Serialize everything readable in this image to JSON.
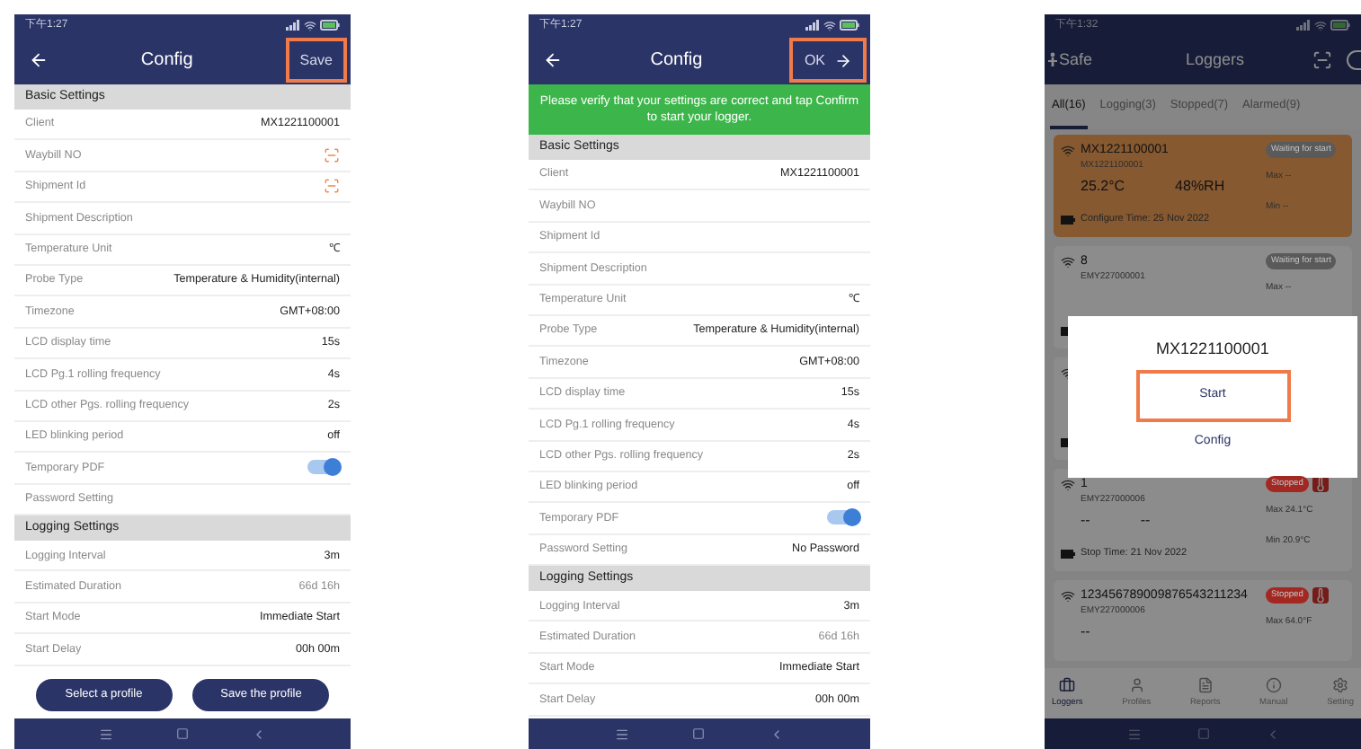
{
  "phones": [
    {
      "kind": "config",
      "status_time": "下午1:27",
      "title": "Config",
      "action": {
        "label": "Save",
        "arrow": false,
        "highlighted": true
      },
      "sections": [
        {
          "heading": "Basic Settings",
          "rows": [
            {
              "kind": "text",
              "label": "Client",
              "value": "MX1221100001"
            },
            {
              "kind": "scan",
              "label": "Waybill NO"
            },
            {
              "kind": "scan",
              "label": "Shipment Id"
            },
            {
              "kind": "text",
              "label": "Shipment Description"
            },
            {
              "kind": "text",
              "label": "Temperature Unit",
              "value": "℃"
            },
            {
              "kind": "text",
              "label": "Probe Type",
              "value": "Temperature & Humidity(internal)"
            },
            {
              "kind": "text",
              "label": "Timezone",
              "value": "GMT+08:00"
            },
            {
              "kind": "text",
              "label": "LCD display time",
              "value": "15s"
            },
            {
              "kind": "text",
              "label": "LCD Pg.1 rolling frequency",
              "value": "4s"
            },
            {
              "kind": "text",
              "label": "LCD other Pgs. rolling frequency",
              "value": "2s"
            },
            {
              "kind": "text",
              "label": "LED blinking period",
              "value": "off"
            },
            {
              "kind": "toggle",
              "label": "Temporary PDF",
              "on": true
            },
            {
              "kind": "text",
              "label": "Password Setting"
            }
          ]
        },
        {
          "heading": "Logging Settings",
          "rows": [
            {
              "kind": "text",
              "label": "Logging Interval",
              "value": "3m"
            },
            {
              "kind": "text",
              "label": "Estimated Duration",
              "value": "66d 16h",
              "muted": true
            },
            {
              "kind": "text",
              "label": "Start Mode",
              "value": "Immediate Start"
            },
            {
              "kind": "text",
              "label": "Start Delay",
              "value": "00h 00m"
            }
          ]
        }
      ],
      "buttons": [
        {
          "label": "Select a profile"
        },
        {
          "label": "Save the profile"
        }
      ]
    },
    {
      "kind": "config",
      "status_time": "下午1:27",
      "title": "Config",
      "action": {
        "label": "OK",
        "arrow": true,
        "highlighted": true
      },
      "banner": "Please verify that your settings are correct and tap Confirm to start your logger.",
      "sections": [
        {
          "heading": "Basic Settings",
          "rows": [
            {
              "kind": "text",
              "label": "Client",
              "value": "MX1221100001"
            },
            {
              "kind": "text",
              "label": "Waybill NO"
            },
            {
              "kind": "text",
              "label": "Shipment Id"
            },
            {
              "kind": "text",
              "label": "Shipment Description"
            },
            {
              "kind": "text",
              "label": "Temperature Unit",
              "value": "℃"
            },
            {
              "kind": "text",
              "label": "Probe Type",
              "value": "Temperature & Humidity(internal)"
            },
            {
              "kind": "text",
              "label": "Timezone",
              "value": "GMT+08:00"
            },
            {
              "kind": "text",
              "label": "LCD display time",
              "value": "15s"
            },
            {
              "kind": "text",
              "label": "LCD Pg.1 rolling frequency",
              "value": "4s"
            },
            {
              "kind": "text",
              "label": "LCD other Pgs. rolling frequency",
              "value": "2s"
            },
            {
              "kind": "text",
              "label": "LED blinking period",
              "value": "off"
            },
            {
              "kind": "toggle",
              "label": "Temporary PDF",
              "on": true
            },
            {
              "kind": "text",
              "label": "Password Setting",
              "value": "No Password"
            }
          ]
        },
        {
          "heading": "Logging Settings",
          "rows": [
            {
              "kind": "text",
              "label": "Logging Interval",
              "value": "3m"
            },
            {
              "kind": "text",
              "label": "Estimated Duration",
              "value": "66d 16h",
              "muted": true
            },
            {
              "kind": "text",
              "label": "Start Mode",
              "value": "Immediate Start"
            },
            {
              "kind": "text",
              "label": "Start Delay",
              "value": "00h 00m"
            }
          ]
        }
      ]
    },
    {
      "kind": "loggers",
      "status_time": "下午1:32",
      "brand": "Safe",
      "title": "Loggers",
      "tabs": [
        {
          "label": "All(16)",
          "selected": true
        },
        {
          "label": "Logging(3)",
          "selected": false
        },
        {
          "label": "Stopped(7)",
          "selected": false
        },
        {
          "label": "Alarmed(9)",
          "selected": false
        }
      ],
      "cards": [
        {
          "selected": true,
          "name": "MX1221100001",
          "id": "MX1221100001",
          "badge": {
            "label": "Waiting for start",
            "color": "#5a5a5a"
          },
          "alarm": false,
          "readings": [
            "25.2°C",
            "48%RH"
          ],
          "footer": "Configure Time: 25 Nov 2022",
          "max": "Max --",
          "min": "Min --"
        },
        {
          "selected": false,
          "name": "8",
          "id": "EMY227000001",
          "badge": {
            "label": "Waiting for start",
            "color": "#5a5a5a"
          },
          "alarm": false,
          "max": "Max --"
        },
        {
          "selected": false
        },
        {
          "selected": false,
          "name": "1",
          "id": "EMY227000006",
          "badge": {
            "label": "Stopped",
            "color": "#a42822"
          },
          "alarm": true,
          "readings": [
            "--",
            "--"
          ],
          "footer": "Stop Time: 21 Nov 2022",
          "max": "Max 24.1°C",
          "min": "Min 20.9°C"
        },
        {
          "selected": false,
          "name": "123456789009876543211234",
          "id": "EMY227000006",
          "badge": {
            "label": "Stopped",
            "color": "#a42822"
          },
          "alarm": true,
          "readings": [
            "--"
          ],
          "max": "Max 64.0°F"
        }
      ],
      "dialog": {
        "title": "MX1221100001",
        "actions": [
          {
            "label": "Start",
            "highlighted": true
          },
          {
            "label": "Config",
            "highlighted": false
          }
        ]
      },
      "bottom_tabs": [
        {
          "kind": "loggers",
          "label": "Loggers",
          "selected": true
        },
        {
          "kind": "profiles",
          "label": "Profiles",
          "selected": false
        },
        {
          "kind": "reports",
          "label": "Reports",
          "selected": false
        },
        {
          "kind": "manual",
          "label": "Manual",
          "selected": false
        },
        {
          "kind": "settings",
          "label": "Setting",
          "selected": false
        }
      ]
    }
  ]
}
